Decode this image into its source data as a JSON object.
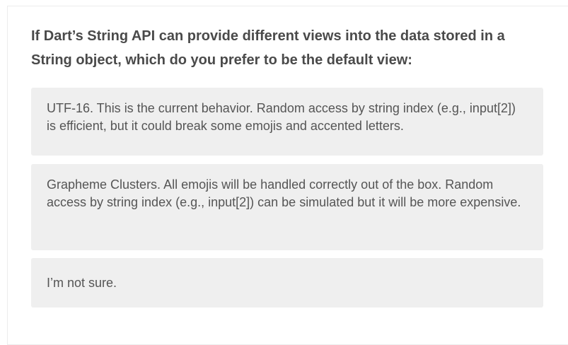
{
  "survey": {
    "question": "If Dart’s String API can provide different views into the data stored in a String object, which do you prefer to be the default view:",
    "options": [
      {
        "label": "UTF-16. This is the current behavior. Random access by string index (e.g., input[2]) is efficient, but it could break some emojis and accented letters."
      },
      {
        "label": "Grapheme Clusters. All emojis will be handled correctly out of the box. Random access by string index (e.g., input[2]) can be simulated but it will be more expensive."
      },
      {
        "label": "I’m not sure."
      }
    ]
  }
}
